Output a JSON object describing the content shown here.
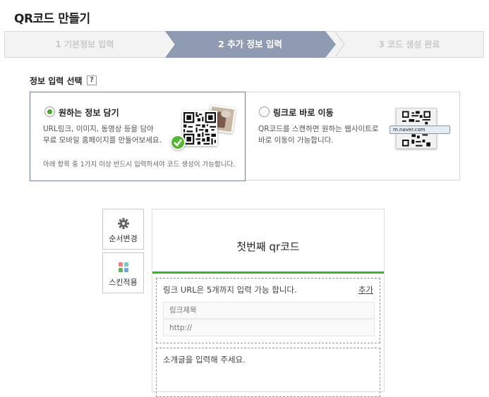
{
  "page": {
    "title": "QR코드 만들기"
  },
  "stepper": {
    "steps": [
      {
        "label": "1 기본정보 입력",
        "state": "done"
      },
      {
        "label": "2 추가 정보 입력",
        "state": "active"
      },
      {
        "label": "3 코드 생성 완료",
        "state": "pending"
      }
    ],
    "colors": {
      "active": "#8f9bb0",
      "inactive": "#f3f3f3",
      "inactive_text": "#c9c9c9"
    }
  },
  "section": {
    "label": "정보 입력 선택",
    "help": "?"
  },
  "options": [
    {
      "title": "원하는 정보 담기",
      "selected": true,
      "desc_line1": "URL링크, 이미지, 동영상 등을 담아",
      "desc_line2": "무료 모바일 홈페이지를 만들어보세요.",
      "note": "아래 항목 중 1가지 이상 반드시 입력하셔야 코드 생성이 가능합니다."
    },
    {
      "title": "링크로 바로 이동",
      "selected": false,
      "desc_line1": "QR코드를 스캔하면 원하는 웹사이트로",
      "desc_line2": "바로 이동이 가능합니다.",
      "url_preview": "m.naver.com"
    }
  ],
  "side_buttons": [
    {
      "label": "순서변경",
      "icon": "gear-icon"
    },
    {
      "label": "스킨적용",
      "icon": "skin-grid-icon"
    }
  ],
  "editor": {
    "title": "첫번째 qr코드",
    "link_info": "링크 URL은 5개까지 입력 가능 합니다.",
    "add_label": "추가",
    "link_title_placeholder": "링크제목",
    "link_url_placeholder": "http://",
    "intro_placeholder": "소개글을 입력해 주세요.",
    "accent": "#3fae29"
  }
}
